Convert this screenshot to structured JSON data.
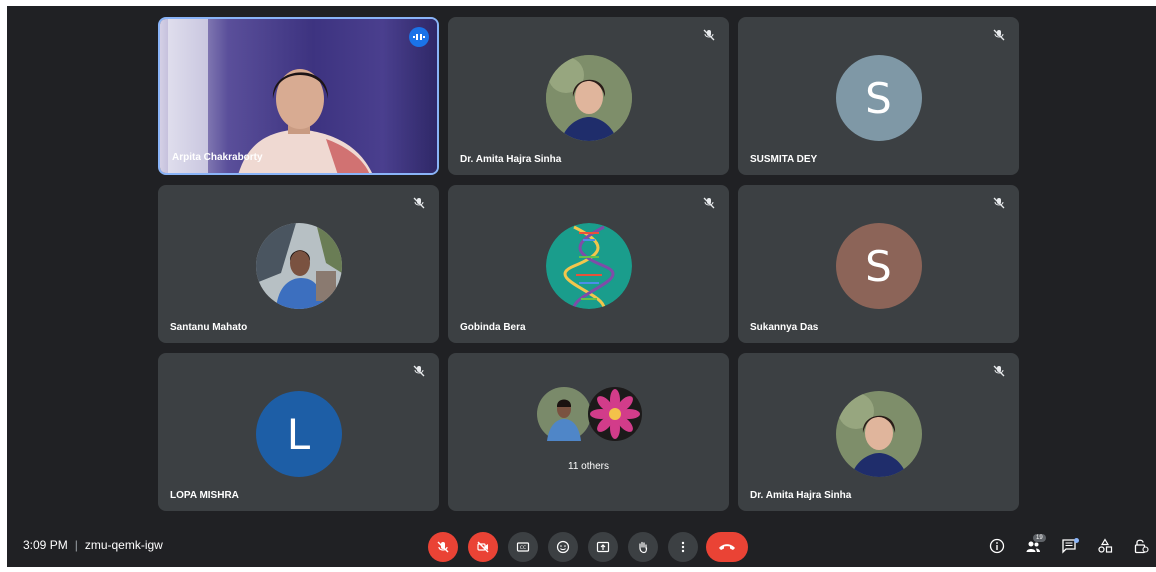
{
  "participants": [
    {
      "name": "Arpita Chakraborty",
      "type": "video"
    },
    {
      "name": "Dr. Amita Hajra Sinha",
      "type": "photo"
    },
    {
      "name": "SUSMITA DEY",
      "type": "letter",
      "letter": "S",
      "color": "#7f98a6"
    },
    {
      "name": "Santanu Mahato",
      "type": "photo"
    },
    {
      "name": "Gobinda Bera",
      "type": "photo"
    },
    {
      "name": "Sukannya Das",
      "type": "letter",
      "letter": "S",
      "color": "#8c6458"
    },
    {
      "name": "LOPA MISHRA",
      "type": "letter",
      "letter": "L",
      "color": "#1d5ea6"
    },
    {
      "name": "Dr. Amita Hajra Sinha",
      "type": "photo"
    }
  ],
  "others": {
    "label": "11 others"
  },
  "meeting": {
    "time": "3:09 PM",
    "separator": "|",
    "code": "zmu-qemk-igw"
  },
  "people_count": "19",
  "icons": {
    "mic": "mic-off-icon",
    "camera": "camera-off-icon",
    "captions": "captions-icon",
    "reactions": "emoji-icon",
    "present": "present-icon",
    "hand": "raise-hand-icon",
    "more": "more-options-icon",
    "hangup": "hang-up-icon",
    "info": "info-icon",
    "people": "people-icon",
    "chat": "chat-icon",
    "activities": "activities-icon",
    "host": "host-controls-icon"
  },
  "colors": {
    "accent": "#8ab4f8",
    "danger": "#ea4335",
    "tile": "#3c4043",
    "background": "#202124"
  }
}
